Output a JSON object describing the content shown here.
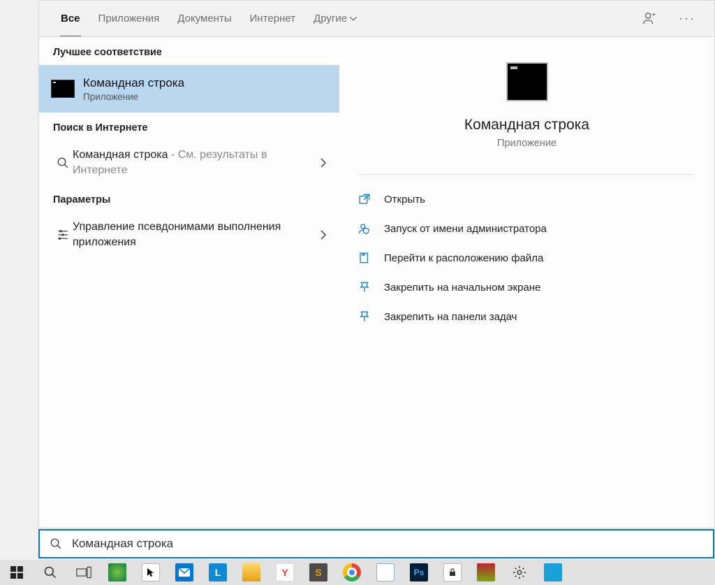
{
  "tabs": {
    "all": "Все",
    "apps": "Приложения",
    "docs": "Документы",
    "internet": "Интернет",
    "other": "Другие"
  },
  "sections": {
    "best_match": "Лучшее соответствие",
    "web_search": "Поиск в Интернете",
    "settings": "Параметры"
  },
  "best_match": {
    "title": "Командная строка",
    "subtitle": "Приложение"
  },
  "web_item": {
    "title": "Командная строка",
    "suffix": " - См. результаты в Интернете"
  },
  "settings_item": {
    "title": "Управление псевдонимами выполнения приложения"
  },
  "preview": {
    "title": "Командная строка",
    "subtitle": "Приложение",
    "actions": {
      "open": "Открыть",
      "run_admin": "Запуск от имени администратора",
      "open_location": "Перейти к расположению файла",
      "pin_start": "Закрепить на начальном экране",
      "pin_taskbar": "Закрепить на панели задач"
    }
  },
  "search": {
    "value": "Командная строка"
  }
}
